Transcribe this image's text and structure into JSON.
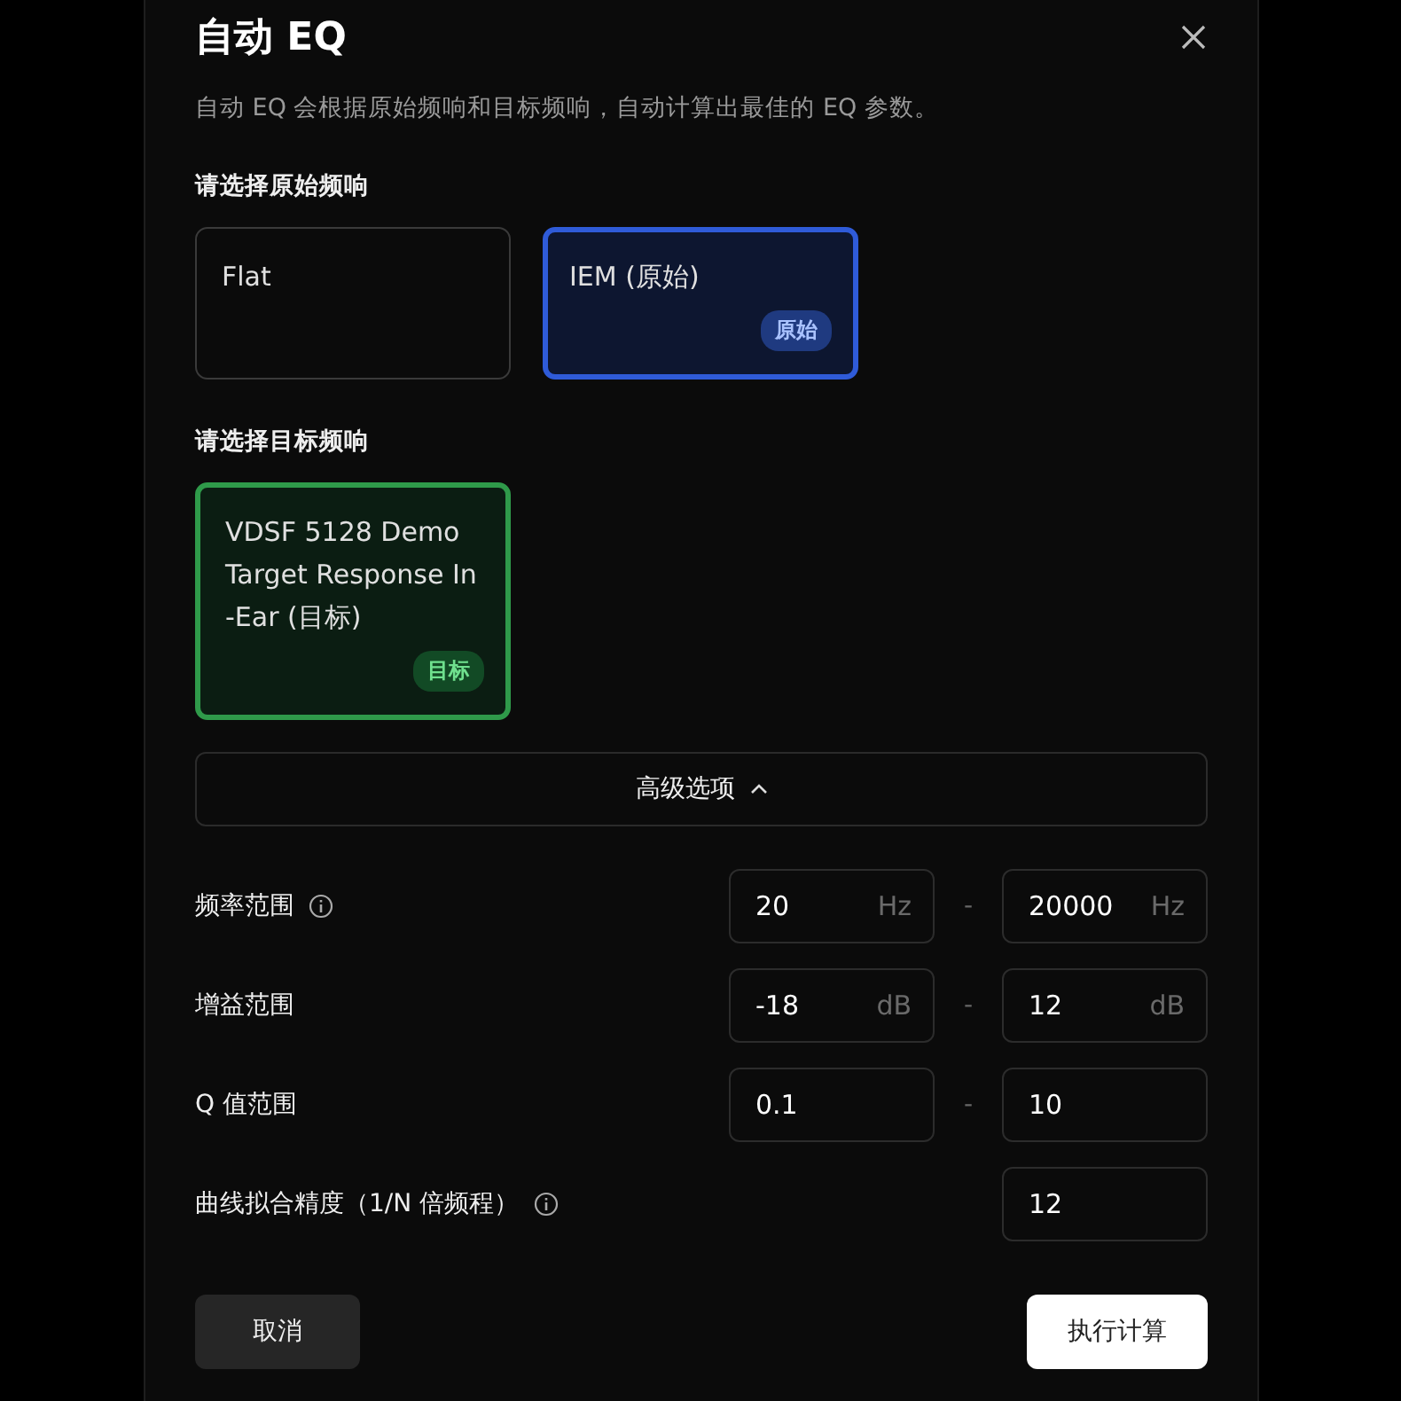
{
  "dialog": {
    "title": "自动 EQ",
    "description": "自动 EQ 会根据原始频响和目标频响，自动计算出最佳的 EQ 参数。"
  },
  "source": {
    "label": "请选择原始频响",
    "options": [
      {
        "name": "Flat",
        "selected": false
      },
      {
        "name": "IEM (原始)",
        "selected": true,
        "badge": "原始"
      }
    ]
  },
  "target": {
    "label": "请选择目标频响",
    "options": [
      {
        "name": "VDSF 5128 Demo Target Response In -Ear (目标)",
        "selected": true,
        "badge": "目标"
      }
    ]
  },
  "advanced": {
    "label": "高级选项",
    "expanded": true
  },
  "params": [
    {
      "label": "频率范围",
      "info": true,
      "fields": [
        {
          "value": "20",
          "unit": "Hz"
        },
        {
          "value": "20000",
          "unit": "Hz"
        }
      ],
      "separator": "-"
    },
    {
      "label": "增益范围",
      "info": false,
      "fields": [
        {
          "value": "-18",
          "unit": "dB"
        },
        {
          "value": "12",
          "unit": "dB"
        }
      ],
      "separator": "-"
    },
    {
      "label": "Q 值范围",
      "info": false,
      "fields": [
        {
          "value": "0.1"
        },
        {
          "value": "10"
        }
      ],
      "separator": "-"
    },
    {
      "label": "曲线拟合精度（1/N 倍频程）",
      "info": true,
      "fields": [
        {
          "value": "12"
        }
      ]
    }
  ],
  "buttons": {
    "cancel": "取消",
    "confirm": "执行计算"
  }
}
